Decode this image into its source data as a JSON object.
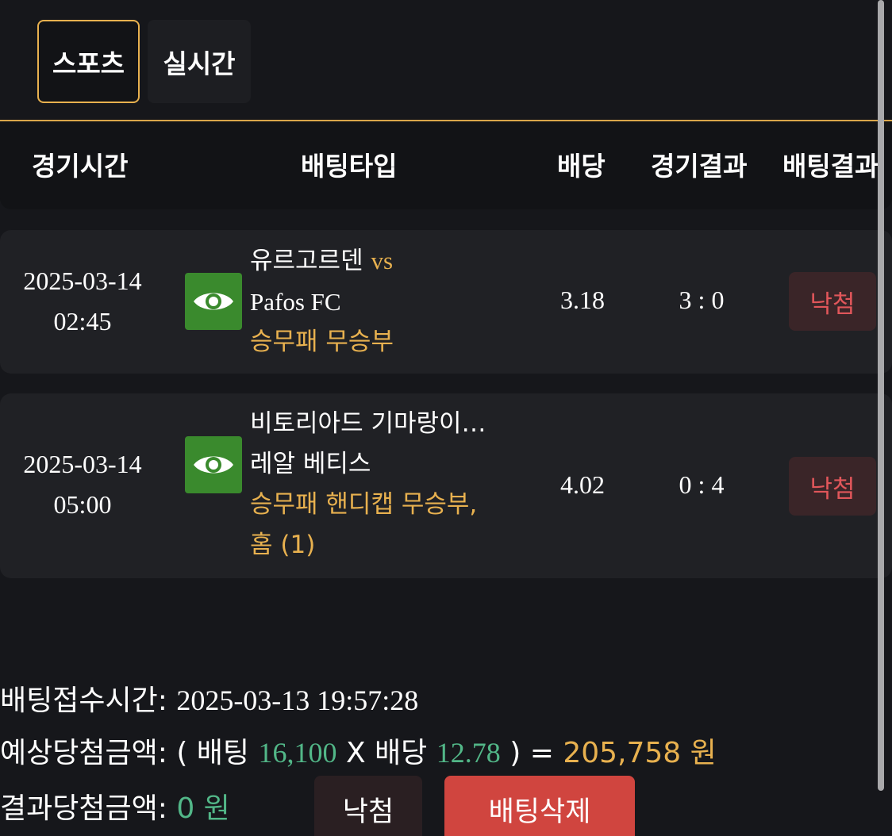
{
  "tabs": [
    {
      "label": "스포츠",
      "active": true
    },
    {
      "label": "실시간",
      "active": false
    }
  ],
  "table": {
    "headers": {
      "time": "경기시간",
      "bet_type": "배팅타입",
      "odds": "배당",
      "game_result": "경기결과",
      "bet_result": "배팅결과"
    },
    "rows": [
      {
        "date": "2025-03-14",
        "time": "02:45",
        "home": "유르고르덴",
        "vs": "vs",
        "away": "Pafos FC",
        "market": "승무패 무승부",
        "market_cont": "",
        "odds": "3.18",
        "score": "3 : 0",
        "result": "낙첨"
      },
      {
        "date": "2025-03-14",
        "time": "05:00",
        "home": "비토리아드 기마랑이…",
        "vs": "",
        "away": "레알 베티스",
        "market": "승무패 핸디캡 무승부,",
        "market_cont": "홈 (1)",
        "odds": "4.02",
        "score": "0 : 4",
        "result": "낙첨"
      }
    ]
  },
  "summary": {
    "received_label": "배팅접수시간:",
    "received_value": "2025-03-13 19:57:28",
    "expected_label": "예상당첨금액:",
    "expected_open": "( 배팅",
    "stake": "16,100",
    "x_label": "X 배당",
    "total_odds": "12.78",
    "expected_close": ") =",
    "expected_amount": "205,758 원",
    "actual_label": "결과당첨금액:",
    "actual_amount": "0 원"
  },
  "buttons": {
    "result": "낙첨",
    "delete": "배팅삭제"
  },
  "colors": {
    "accent": "#e8b14f",
    "green": "#52b788",
    "loss_red": "#e0565a",
    "delete_red": "#d0453f",
    "eye_green": "#3a8a2d"
  },
  "icons": {
    "detail": "eye-icon"
  }
}
